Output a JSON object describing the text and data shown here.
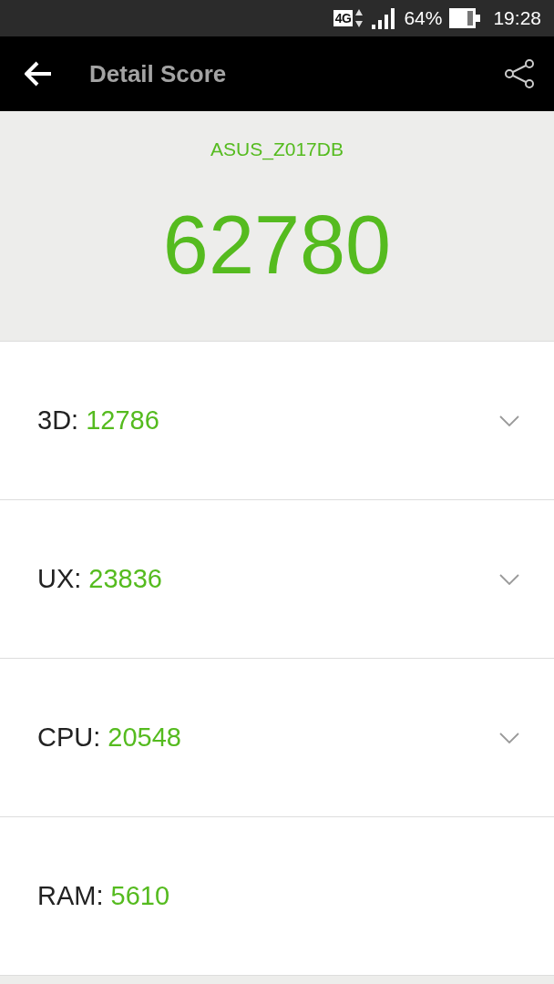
{
  "status_bar": {
    "network": "4G",
    "battery": "64%",
    "time": "19:28"
  },
  "toolbar": {
    "title": "Detail Score"
  },
  "summary": {
    "device": "ASUS_Z017DB",
    "score": "62780"
  },
  "scores": [
    {
      "label": "3D:",
      "value": "12786",
      "kind": "expandable",
      "expanded": false
    },
    {
      "label": "UX:",
      "value": "23836",
      "kind": "expandable",
      "expanded": false
    },
    {
      "label": "CPU:",
      "value": "20548",
      "kind": "expandable",
      "expanded": false
    },
    {
      "label": "RAM:",
      "value": "5610",
      "kind": "plain"
    }
  ]
}
